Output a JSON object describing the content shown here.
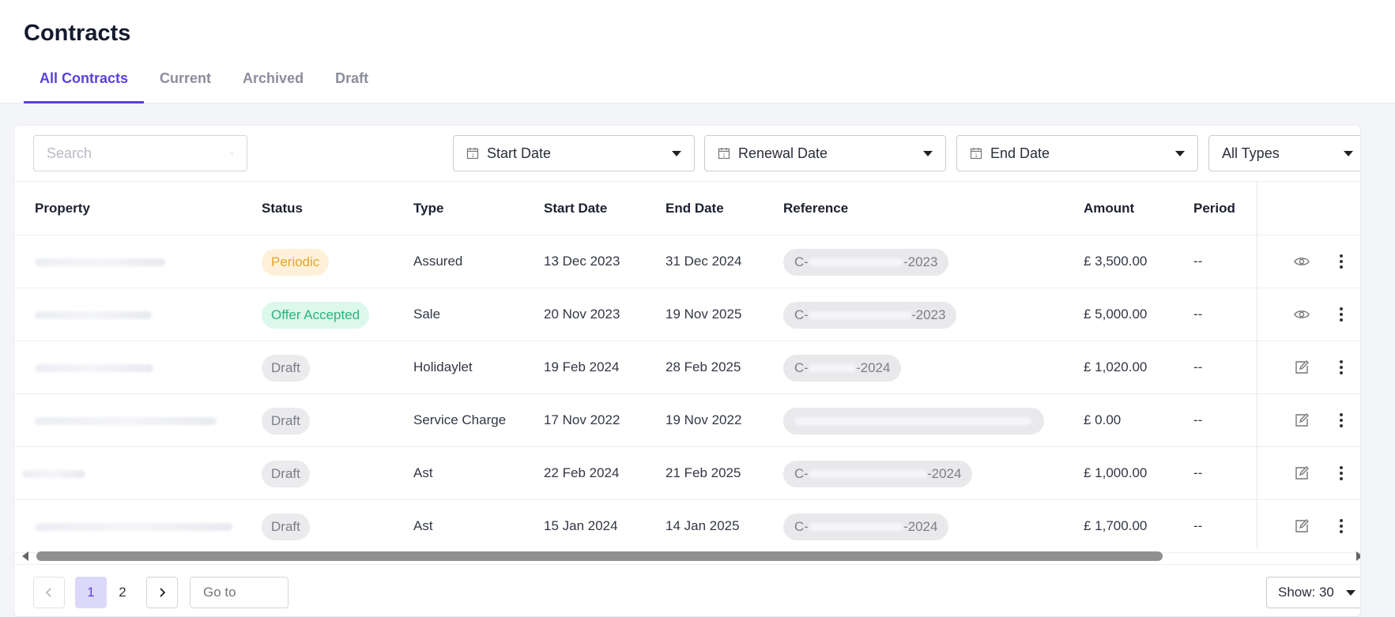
{
  "page": {
    "title": "Contracts",
    "tabs": [
      {
        "label": "All Contracts",
        "active": true
      },
      {
        "label": "Current"
      },
      {
        "label": "Archived"
      },
      {
        "label": "Draft"
      }
    ]
  },
  "filters": {
    "search_placeholder": "Search",
    "start_date": "Start Date",
    "renewal_date": "Renewal Date",
    "end_date": "End Date",
    "type": "All Types"
  },
  "table": {
    "columns": [
      "Property",
      "Status",
      "Type",
      "Start Date",
      "End Date",
      "Reference",
      "Amount",
      "Period"
    ],
    "rows": [
      {
        "status": "Periodic",
        "status_kind": "periodic",
        "type": "Assured",
        "start": "13 Dec 2023",
        "end": "31 Dec 2024",
        "ref_prefix": "C-",
        "ref_suffix": "-2023",
        "amount": "£ 3,500.00",
        "period": "--",
        "action": "view"
      },
      {
        "status": "Offer Accepted",
        "status_kind": "offer",
        "type": "Sale",
        "start": "20 Nov 2023",
        "end": "19 Nov 2025",
        "ref_prefix": "C-",
        "ref_suffix": "-2023",
        "amount": "£ 5,000.00",
        "period": "--",
        "action": "view"
      },
      {
        "status": "Draft",
        "status_kind": "draft",
        "type": "Holidaylet",
        "start": "19 Feb 2024",
        "end": "28 Feb 2025",
        "ref_prefix": "C-",
        "ref_suffix": "-2024",
        "amount": "£ 1,020.00",
        "period": "--",
        "action": "edit"
      },
      {
        "status": "Draft",
        "status_kind": "draft",
        "type": "Service Charge",
        "start": "17 Nov 2022",
        "end": "19 Nov 2022",
        "ref_prefix": "",
        "ref_suffix": "",
        "amount": "£ 0.00",
        "period": "--",
        "action": "edit"
      },
      {
        "status": "Draft",
        "status_kind": "draft",
        "type": "Ast",
        "start": "22 Feb 2024",
        "end": "21 Feb 2025",
        "ref_prefix": "C-",
        "ref_suffix": "-2024",
        "amount": "£ 1,000.00",
        "period": "--",
        "action": "edit"
      },
      {
        "status": "Draft",
        "status_kind": "draft",
        "type": "Ast",
        "start": "15 Jan 2024",
        "end": "14 Jan 2025",
        "ref_prefix": "C-",
        "ref_suffix": "-2024",
        "amount": "£ 1,700.00",
        "period": "--",
        "action": "edit"
      }
    ]
  },
  "pagination": {
    "pages": [
      "1",
      "2"
    ],
    "current": "1",
    "goto_placeholder": "Go to",
    "show_label": "Show: 30"
  },
  "colors": {
    "accent": "#5b3fe0",
    "periodic": "#e4a52b",
    "offer": "#2bb37d",
    "draft": "#7a7d88"
  }
}
